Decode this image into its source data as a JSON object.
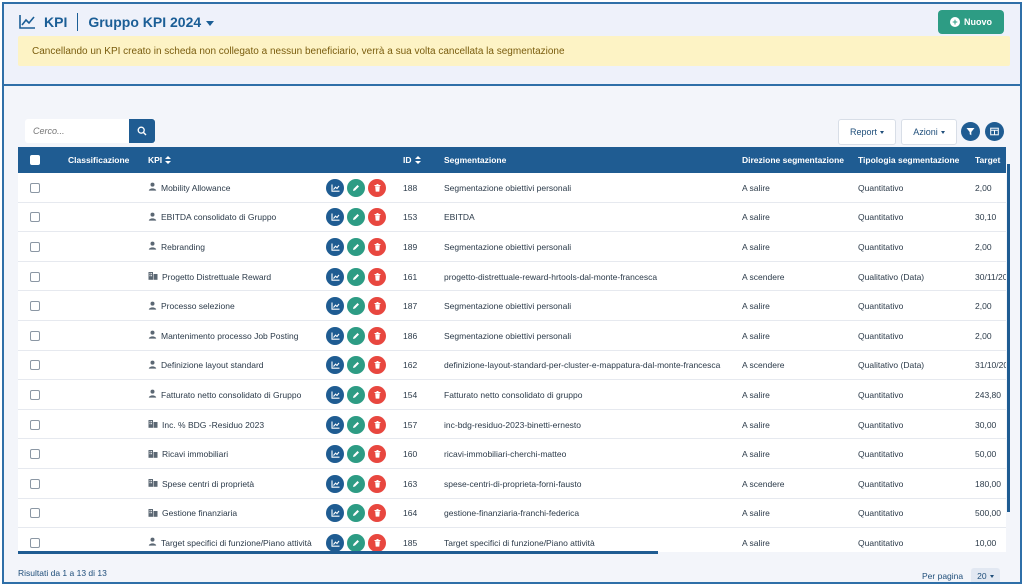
{
  "header": {
    "section": "KPI",
    "group": "Gruppo KPI 2024",
    "new_label": "Nuovo"
  },
  "alert": {
    "text": "Cancellando un KPI creato in scheda non collegato a nessun beneficiario, verrà a sua volta cancellata la segmentazione"
  },
  "toolbar": {
    "search_placeholder": "Cerco...",
    "report_label": "Report",
    "actions_label": "Azioni"
  },
  "table": {
    "headers": {
      "classificazione": "Classificazione",
      "kpi": "KPI",
      "id": "ID",
      "segmentazione": "Segmentazione",
      "direzione": "Direzione segmentazione",
      "tipologia": "Tipologia segmentazione",
      "target": "Target"
    },
    "rows": [
      {
        "icon": "user-icon",
        "kpi": "Mobility Allowance",
        "id": "188",
        "segmentazione": "Segmentazione obiettivi personali",
        "direzione": "A salire",
        "tipologia": "Quantitativo",
        "target": "2,00"
      },
      {
        "icon": "user-icon",
        "kpi": "EBITDA consolidato di Gruppo",
        "id": "153",
        "segmentazione": "EBITDA",
        "direzione": "A salire",
        "tipologia": "Quantitativo",
        "target": "30,10"
      },
      {
        "icon": "user-icon",
        "kpi": "Rebranding",
        "id": "189",
        "segmentazione": "Segmentazione obiettivi personali",
        "direzione": "A salire",
        "tipologia": "Quantitativo",
        "target": "2,00"
      },
      {
        "icon": "building-icon",
        "kpi": "Progetto Distrettuale Reward",
        "id": "161",
        "segmentazione": "progetto-distrettuale-reward-hrtools-dal-monte-francesca",
        "direzione": "A scendere",
        "tipologia": "Qualitativo (Data)",
        "target": "30/11/20"
      },
      {
        "icon": "user-icon",
        "kpi": "Processo selezione",
        "id": "187",
        "segmentazione": "Segmentazione obiettivi personali",
        "direzione": "A salire",
        "tipologia": "Quantitativo",
        "target": "2,00"
      },
      {
        "icon": "user-icon",
        "kpi": "Mantenimento processo Job Posting",
        "id": "186",
        "segmentazione": "Segmentazione obiettivi personali",
        "direzione": "A salire",
        "tipologia": "Quantitativo",
        "target": "2,00"
      },
      {
        "icon": "user-icon",
        "kpi": "Definizione layout standard",
        "id": "162",
        "segmentazione": "definizione-layout-standard-per-cluster-e-mappatura-dal-monte-francesca",
        "direzione": "A scendere",
        "tipologia": "Qualitativo (Data)",
        "target": "31/10/20"
      },
      {
        "icon": "user-icon",
        "kpi": "Fatturato netto consolidato di Gruppo",
        "id": "154",
        "segmentazione": "Fatturato netto consolidato di gruppo",
        "direzione": "A salire",
        "tipologia": "Quantitativo",
        "target": "243,80"
      },
      {
        "icon": "building-icon",
        "kpi": "Inc. % BDG -Residuo 2023",
        "id": "157",
        "segmentazione": "inc-bdg-residuo-2023-binetti-ernesto",
        "direzione": "A salire",
        "tipologia": "Quantitativo",
        "target": "30,00"
      },
      {
        "icon": "building-icon",
        "kpi": "Ricavi immobiliari",
        "id": "160",
        "segmentazione": "ricavi-immobiliari-cherchi-matteo",
        "direzione": "A salire",
        "tipologia": "Quantitativo",
        "target": "50,00"
      },
      {
        "icon": "building-icon",
        "kpi": "Spese centri di proprietà",
        "id": "163",
        "segmentazione": "spese-centri-di-proprieta-forni-fausto",
        "direzione": "A scendere",
        "tipologia": "Quantitativo",
        "target": "180,00"
      },
      {
        "icon": "building-icon",
        "kpi": "Gestione finanziaria",
        "id": "164",
        "segmentazione": "gestione-finanziaria-franchi-federica",
        "direzione": "A salire",
        "tipologia": "Quantitativo",
        "target": "500,00"
      },
      {
        "icon": "user-icon",
        "kpi": "Target specifici di funzione/Piano attività",
        "id": "185",
        "segmentazione": "Target specifici di funzione/Piano attività",
        "direzione": "A salire",
        "tipologia": "Quantitativo",
        "target": "10,00"
      }
    ]
  },
  "footer": {
    "results": "Risultati da 1 a 13 di 13",
    "per_page_label": "Per pagina",
    "per_page_value": "20"
  },
  "colors": {
    "primary": "#1f5c92",
    "success": "#2d9c84",
    "danger": "#e8473f",
    "alert_bg": "#fdf3c5"
  }
}
